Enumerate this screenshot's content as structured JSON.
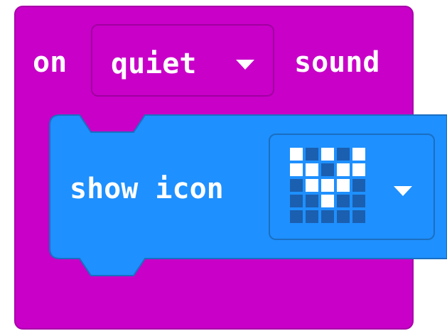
{
  "event_block": {
    "on_label": "on",
    "level_value": "quiet",
    "sound_label": "sound",
    "color": "#c800c8"
  },
  "statement_block": {
    "label": "show icon",
    "color": "#1e90ff",
    "icon_name": "heart-outline",
    "led_pattern": [
      [
        1,
        0,
        1,
        0,
        1
      ],
      [
        1,
        1,
        0,
        1,
        1
      ],
      [
        0,
        1,
        1,
        1,
        0
      ],
      [
        0,
        0,
        1,
        0,
        0
      ],
      [
        0,
        0,
        0,
        0,
        0
      ]
    ]
  },
  "icons": {
    "dropdown_caret": "chevron-down-icon"
  }
}
